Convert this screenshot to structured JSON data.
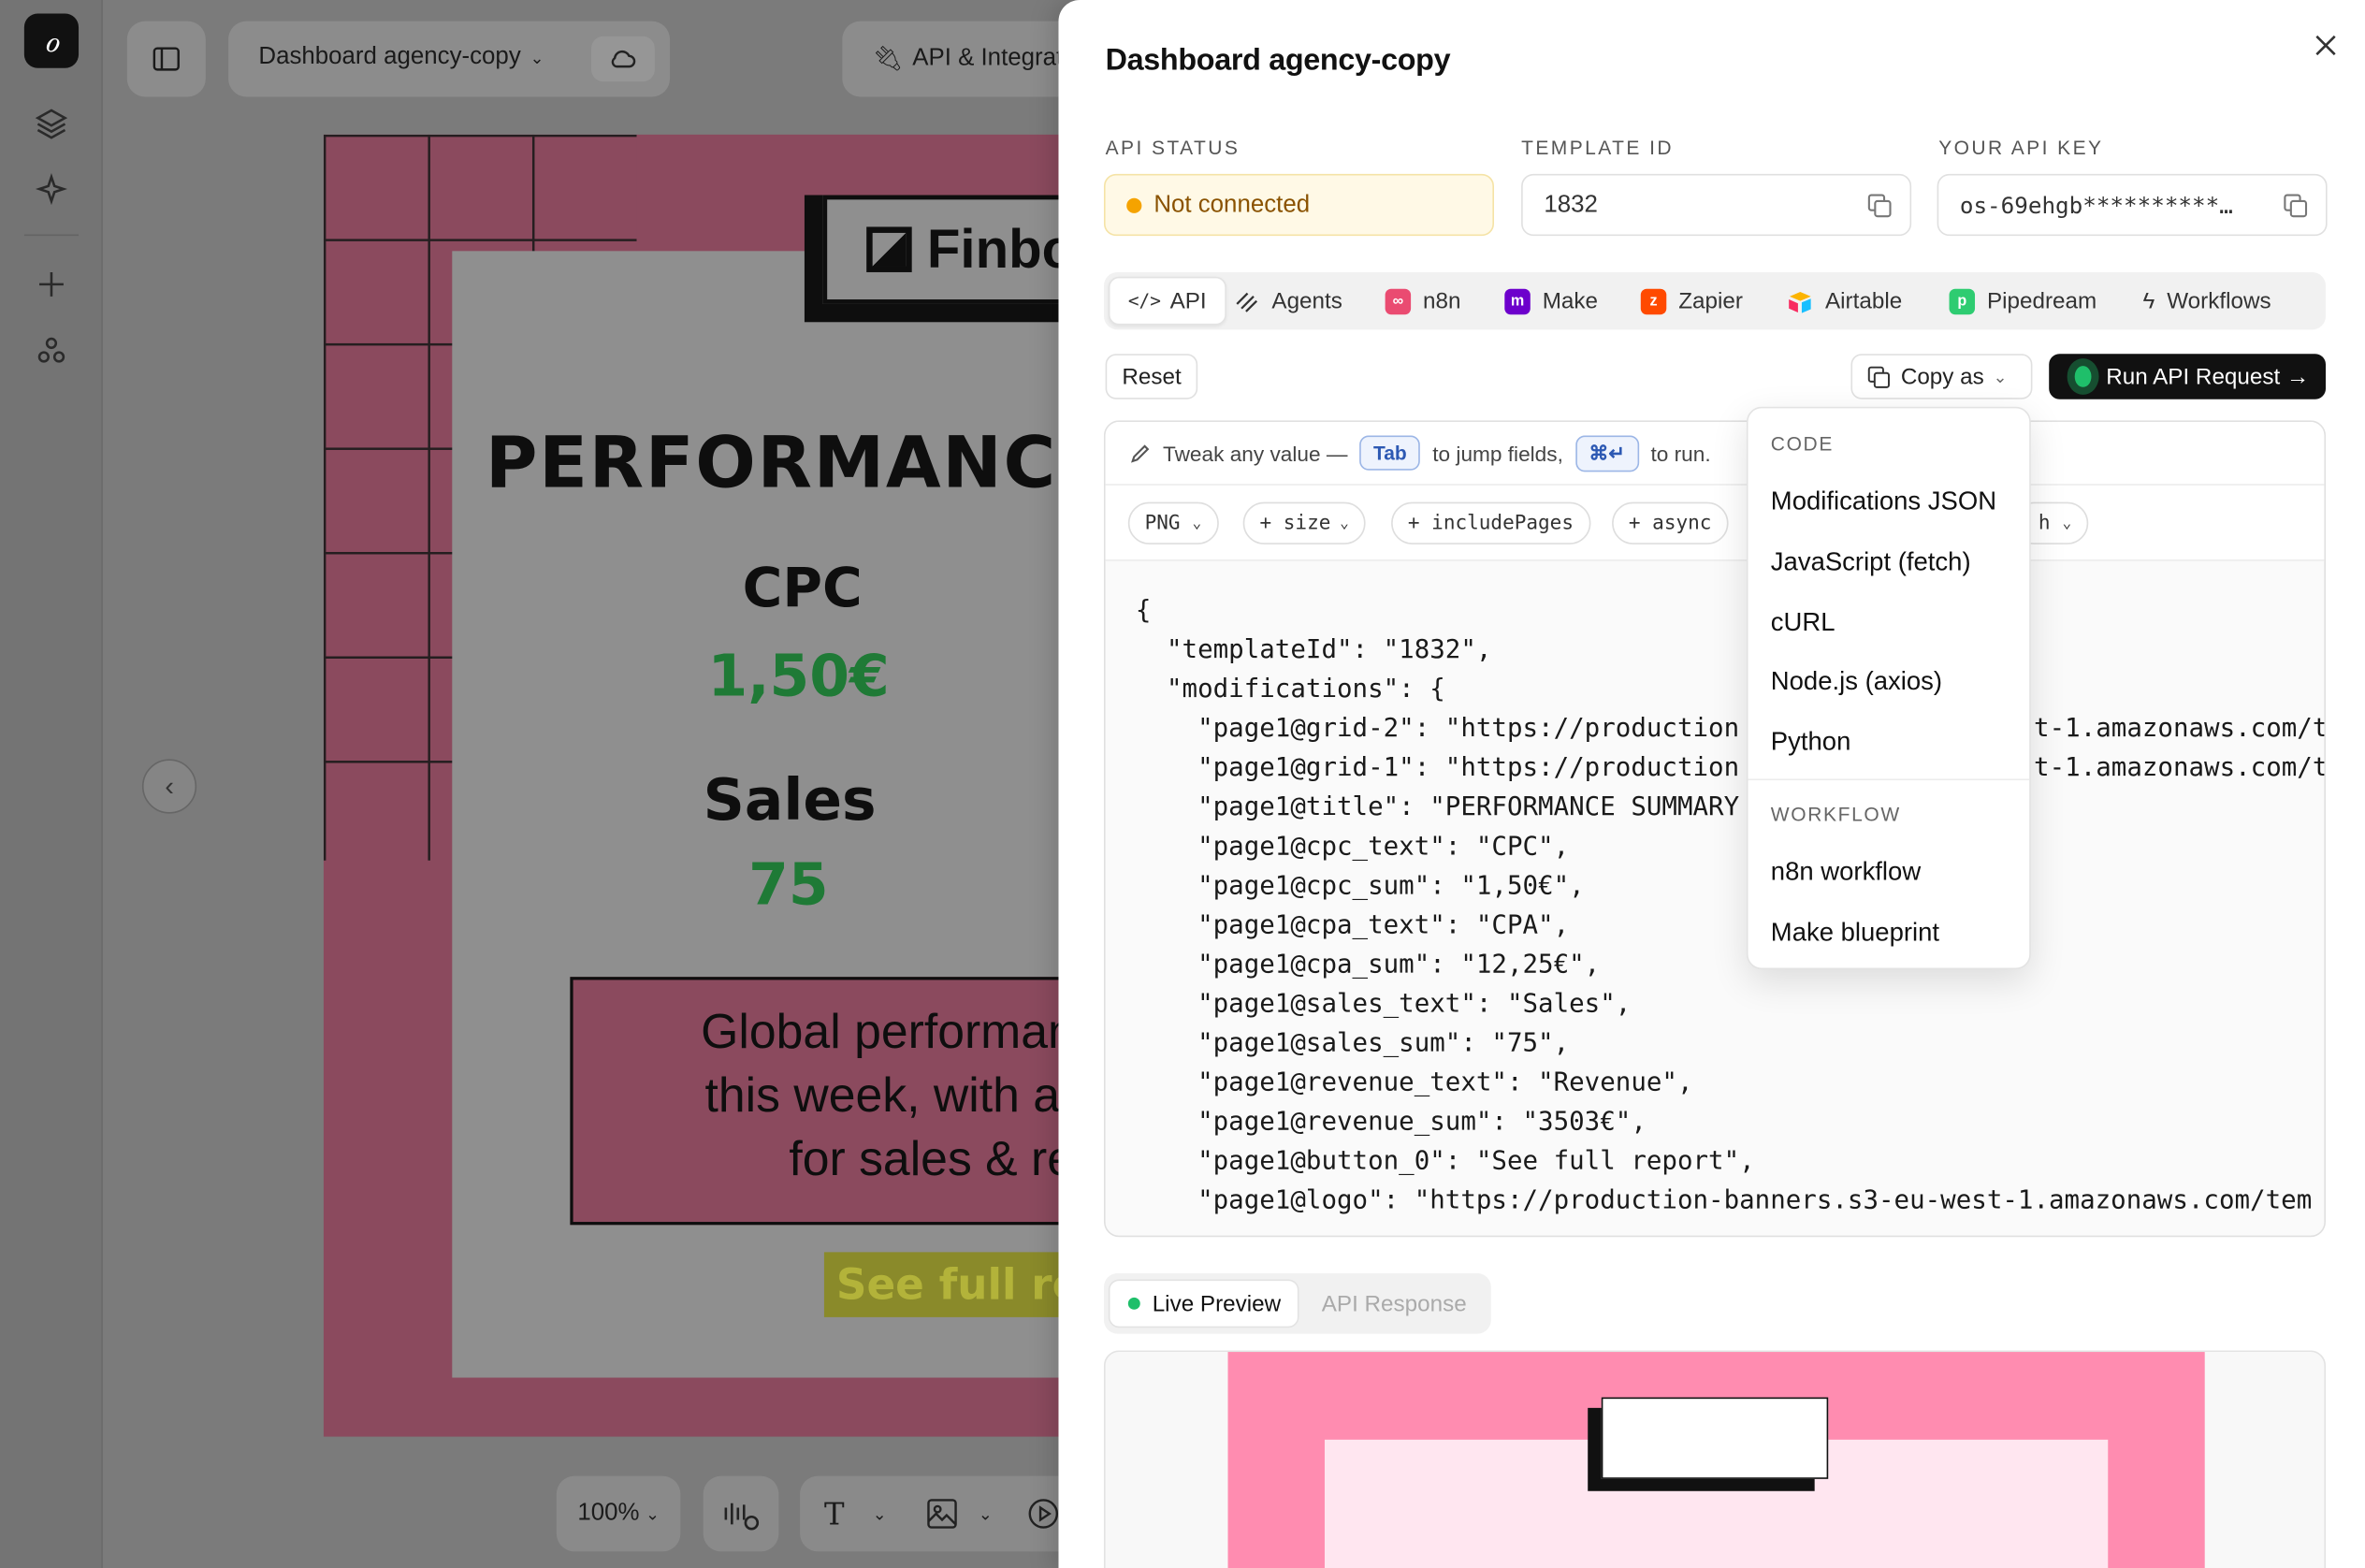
{
  "canvas": {
    "project_name": "Dashboard agency-copy",
    "api_button": "API & Integrat",
    "zoom": "100%",
    "design": {
      "brand": "Finbo",
      "headline": "PERFORMANCE",
      "cpc_label": "CPC",
      "cpc_value": "1,50€",
      "sales_label": "Sales",
      "sales_value": "75",
      "summary_lines": [
        "Global performance",
        "this week, with a all",
        "for sales & rev"
      ],
      "button_text": "See full rep"
    }
  },
  "modal": {
    "title": "Dashboard agency-copy",
    "api_status": {
      "label": "API STATUS",
      "value": "Not connected",
      "dot_color": "#f5a300"
    },
    "template_id": {
      "label": "TEMPLATE ID",
      "value": "1832"
    },
    "api_key": {
      "label": "YOUR API KEY",
      "value": "os-69ehgb**********…"
    },
    "tabs": [
      {
        "label": "API",
        "icon": "code-icon"
      },
      {
        "label": "Agents",
        "icon": "agents-icon"
      },
      {
        "label": "n8n",
        "icon": "n8n-icon",
        "color": "#ea4b71"
      },
      {
        "label": "Make",
        "icon": "make-icon",
        "color": "#6d00cc"
      },
      {
        "label": "Zapier",
        "icon": "zapier-icon",
        "color": "#ff4a00"
      },
      {
        "label": "Airtable",
        "icon": "airtable-icon"
      },
      {
        "label": "Pipedream",
        "icon": "pipedream-icon",
        "color": "#2ecc71"
      },
      {
        "label": "Workflows",
        "icon": "bolt-icon"
      }
    ],
    "reset_label": "Reset",
    "copy_as_label": "Copy as",
    "run_label": "Run API Request →",
    "hint": {
      "prefix": "Tweak any value —",
      "tab_key": "Tab",
      "middle": "to jump fields,",
      "run_key": "⌘↵",
      "suffix": "to run."
    },
    "pills": [
      "PNG",
      "+ size",
      "+ includePages",
      "+ async",
      "h"
    ],
    "code_lines": [
      "{",
      "  \"templateId\": \"1832\",",
      "  \"modifications\": {",
      "    \"page1@grid-2\": \"https://production",
      "    \"page1@grid-1\": \"https://production",
      "    \"page1@title\": \"PERFORMANCE SUMMARY",
      "    \"page1@cpc_text\": \"CPC\",",
      "    \"page1@cpc_sum\": \"1,50€\",",
      "    \"page1@cpa_text\": \"CPA\",",
      "    \"page1@cpa_sum\": \"12,25€\",",
      "    \"page1@sales_text\": \"Sales\",",
      "    \"page1@sales_sum\": \"75\",",
      "    \"page1@revenue_text\": \"Revenue\",",
      "    \"page1@revenue_sum\": \"3503€\",",
      "    \"page1@button_0\": \"See full report\",",
      "    \"page1@logo\": \"https://production-banners.s3-eu-west-1.amazonaws.com/tem"
    ],
    "code_right": [
      "t-1.amazonaws.com/t",
      "t-1.amazonaws.com/t"
    ],
    "copy_menu": {
      "code_header": "CODE",
      "code_items": [
        "Modifications JSON",
        "JavaScript (fetch)",
        "cURL",
        "Node.js (axios)",
        "Python"
      ],
      "workflow_header": "WORKFLOW",
      "workflow_items": [
        "n8n workflow",
        "Make blueprint"
      ]
    },
    "preview_tabs": {
      "live": "Live Preview",
      "response": "API Response"
    },
    "colors": {
      "accent_green": "#1fbf6a",
      "run_bg": "#111111"
    }
  }
}
